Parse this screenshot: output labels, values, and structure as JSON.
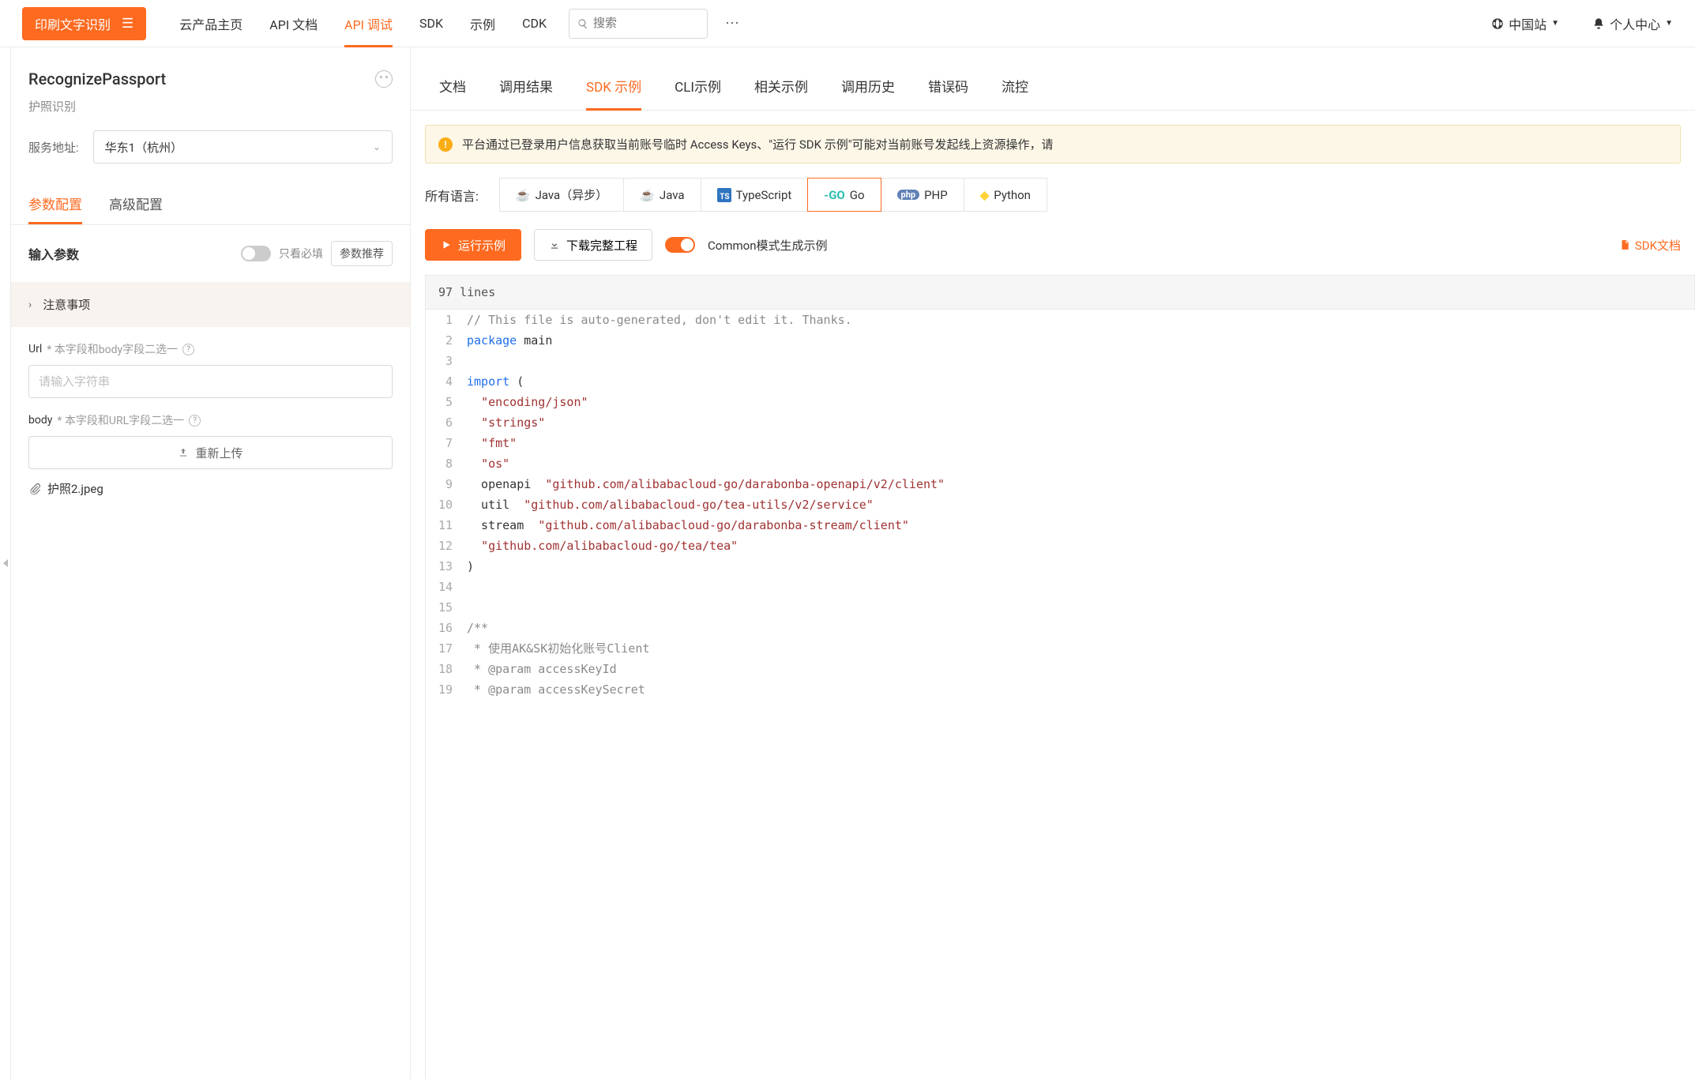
{
  "header": {
    "product_name": "印刷文字识别",
    "nav": [
      "云产品主页",
      "API 文档",
      "API 调试",
      "SDK",
      "示例",
      "CDK"
    ],
    "nav_active_index": 2,
    "search_placeholder": "搜索",
    "region": "中国站",
    "user_center": "个人中心"
  },
  "left_panel": {
    "api_name": "RecognizePassport",
    "api_desc": "护照识别",
    "endpoint_label": "服务地址:",
    "endpoint_value": "华东1（杭州）",
    "tabs": [
      "参数配置",
      "高级配置"
    ],
    "tabs_active_index": 0,
    "params_title": "输入参数",
    "only_required_label": "只看必填",
    "recommend_label": "参数推荐",
    "notice_title": "注意事项",
    "fields": {
      "url": {
        "name": "Url",
        "hint": "* 本字段和body字段二选一",
        "placeholder": "请输入字符串"
      },
      "body": {
        "name": "body",
        "hint": "* 本字段和URL字段二选一",
        "reupload_label": "重新上传",
        "file_name": "护照2.jpeg"
      }
    }
  },
  "right_panel": {
    "tabs": [
      "文档",
      "调用结果",
      "SDK 示例",
      "CLI示例",
      "相关示例",
      "调用历史",
      "错误码",
      "流控"
    ],
    "tabs_active_index": 2,
    "warning_text": "平台通过已登录用户信息获取当前账号临时 Access Keys、\"运行 SDK 示例\"可能对当前账号发起线上资源操作，请",
    "lang_label": "所有语言:",
    "langs": [
      "Java（异步）",
      "Java",
      "TypeScript",
      "Go",
      "PHP",
      "Python"
    ],
    "lang_active_index": 3,
    "run_label": "运行示例",
    "download_label": "下载完整工程",
    "mode_label": "Common模式生成示例",
    "sdk_docs_label": "SDK文档",
    "code_header": "97 lines",
    "code_lines": [
      {
        "n": 1,
        "segs": [
          {
            "t": "// This file is auto-generated, don't edit it. Thanks.",
            "c": "c-cmt"
          }
        ]
      },
      {
        "n": 2,
        "segs": [
          {
            "t": "package",
            "c": "c-kw"
          },
          {
            "t": " main"
          }
        ]
      },
      {
        "n": 3,
        "segs": []
      },
      {
        "n": 4,
        "segs": [
          {
            "t": "import",
            "c": "c-kw"
          },
          {
            "t": " ("
          }
        ]
      },
      {
        "n": 5,
        "indent": 1,
        "segs": [
          {
            "t": "\"encoding/json\"",
            "c": "c-str"
          }
        ]
      },
      {
        "n": 6,
        "indent": 1,
        "segs": [
          {
            "t": "\"strings\"",
            "c": "c-str"
          }
        ]
      },
      {
        "n": 7,
        "indent": 1,
        "segs": [
          {
            "t": "\"fmt\"",
            "c": "c-str"
          }
        ]
      },
      {
        "n": 8,
        "indent": 1,
        "segs": [
          {
            "t": "\"os\"",
            "c": "c-str"
          }
        ]
      },
      {
        "n": 9,
        "indent": 1,
        "segs": [
          {
            "t": "openapi  "
          },
          {
            "t": "\"github.com/alibabacloud-go/darabonba-openapi/v2/client\"",
            "c": "c-str"
          }
        ]
      },
      {
        "n": 10,
        "indent": 1,
        "segs": [
          {
            "t": "util  "
          },
          {
            "t": "\"github.com/alibabacloud-go/tea-utils/v2/service\"",
            "c": "c-str"
          }
        ]
      },
      {
        "n": 11,
        "indent": 1,
        "segs": [
          {
            "t": "stream  "
          },
          {
            "t": "\"github.com/alibabacloud-go/darabonba-stream/client\"",
            "c": "c-str"
          }
        ]
      },
      {
        "n": 12,
        "indent": 1,
        "segs": [
          {
            "t": "\"github.com/alibabacloud-go/tea/tea\"",
            "c": "c-str"
          }
        ]
      },
      {
        "n": 13,
        "segs": [
          {
            "t": ")"
          }
        ]
      },
      {
        "n": 14,
        "segs": []
      },
      {
        "n": 15,
        "segs": []
      },
      {
        "n": 16,
        "segs": [
          {
            "t": "/**",
            "c": "c-cmt"
          }
        ]
      },
      {
        "n": 17,
        "segs": [
          {
            "t": " * 使用AK&SK初始化账号Client",
            "c": "c-cmt"
          }
        ]
      },
      {
        "n": 18,
        "segs": [
          {
            "t": " * @param accessKeyId",
            "c": "c-cmt"
          }
        ]
      },
      {
        "n": 19,
        "segs": [
          {
            "t": " * @param accessKeySecret",
            "c": "c-cmt"
          }
        ]
      }
    ]
  }
}
